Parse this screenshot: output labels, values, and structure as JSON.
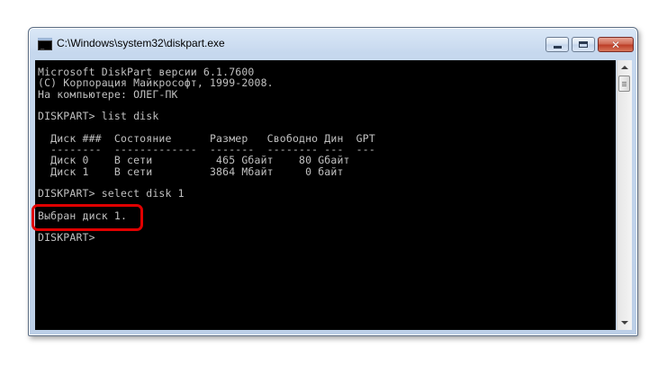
{
  "window": {
    "title": "C:\\Windows\\system32\\diskpart.exe",
    "controls": {
      "minimize": "minimize",
      "maximize": "maximize",
      "close": "✕"
    }
  },
  "console": {
    "lines": [
      "Microsoft DiskPart версии 6.1.7600",
      "(C) Корпорация Майкрософт, 1999-2008.",
      "На компьютере: ОЛЕГ-ПК",
      "",
      "DISKPART> list disk",
      "",
      "  Диск ###  Состояние      Размер   Свободно Дин  GPT",
      "  --------  -------------  -------  -------- ---  ---",
      "  Диск 0    В сети          465 Gбайт    80 Gбайт",
      "  Диск 1    В сети         3864 Мбайт     0 байт",
      "",
      "DISKPART> select disk 1",
      "",
      "Выбран диск 1.",
      "",
      "DISKPART>"
    ]
  },
  "highlight": {
    "color": "#e00000",
    "target": "Выбран диск 1."
  },
  "colors": {
    "console_bg": "#000000",
    "console_fg": "#c0c0c0"
  }
}
